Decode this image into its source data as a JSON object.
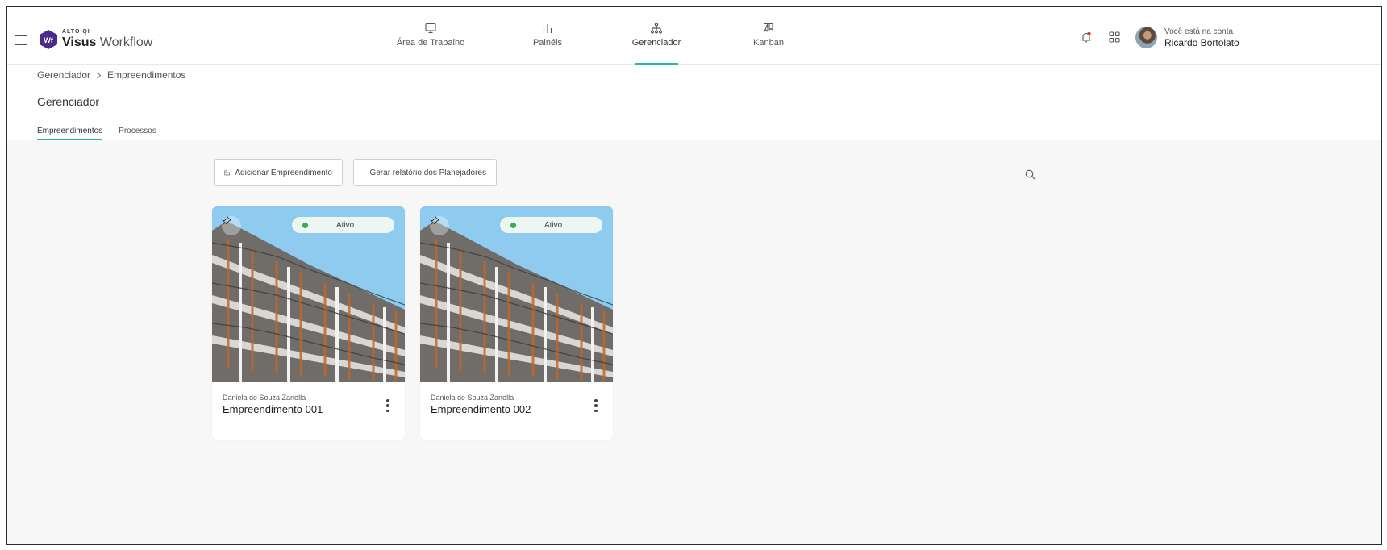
{
  "app": {
    "logo_small": "ALTO QI",
    "logo_brand": "Visus",
    "logo_product": "Workflow",
    "logo_badge": "Wf"
  },
  "nav": {
    "items": [
      {
        "label": "Área de Trabalho",
        "icon": "monitor-icon",
        "active": false
      },
      {
        "label": "Painéis",
        "icon": "bar-chart-icon",
        "active": false
      },
      {
        "label": "Gerenciador",
        "icon": "sitemap-icon",
        "active": true
      },
      {
        "label": "Kanban",
        "icon": "kanban-icon",
        "active": false
      }
    ]
  },
  "account": {
    "subtitle": "Você está na conta",
    "name": "Ricardo Bortolato"
  },
  "breadcrumb": [
    "Gerenciador",
    "Empreendimentos"
  ],
  "page_title": "Gerenciador",
  "tabs": [
    {
      "label": "Empreendimentos",
      "active": true
    },
    {
      "label": "Processos",
      "active": false
    }
  ],
  "toolbar": {
    "add_label": "Adicionar Empreendimento",
    "report_label": "Gerar relatório dos Planejadores"
  },
  "cards": [
    {
      "status": "Ativo",
      "owner": "Daniela de Souza Zanella",
      "title": "Empreendimento 001"
    },
    {
      "status": "Ativo",
      "owner": "Daniela de Souza Zanella",
      "title": "Empreendimento 002"
    }
  ],
  "colors": {
    "accent": "#26b6a7",
    "logo": "#4b2a8a",
    "status_active": "#2cb34a",
    "notification": "#e53935"
  }
}
